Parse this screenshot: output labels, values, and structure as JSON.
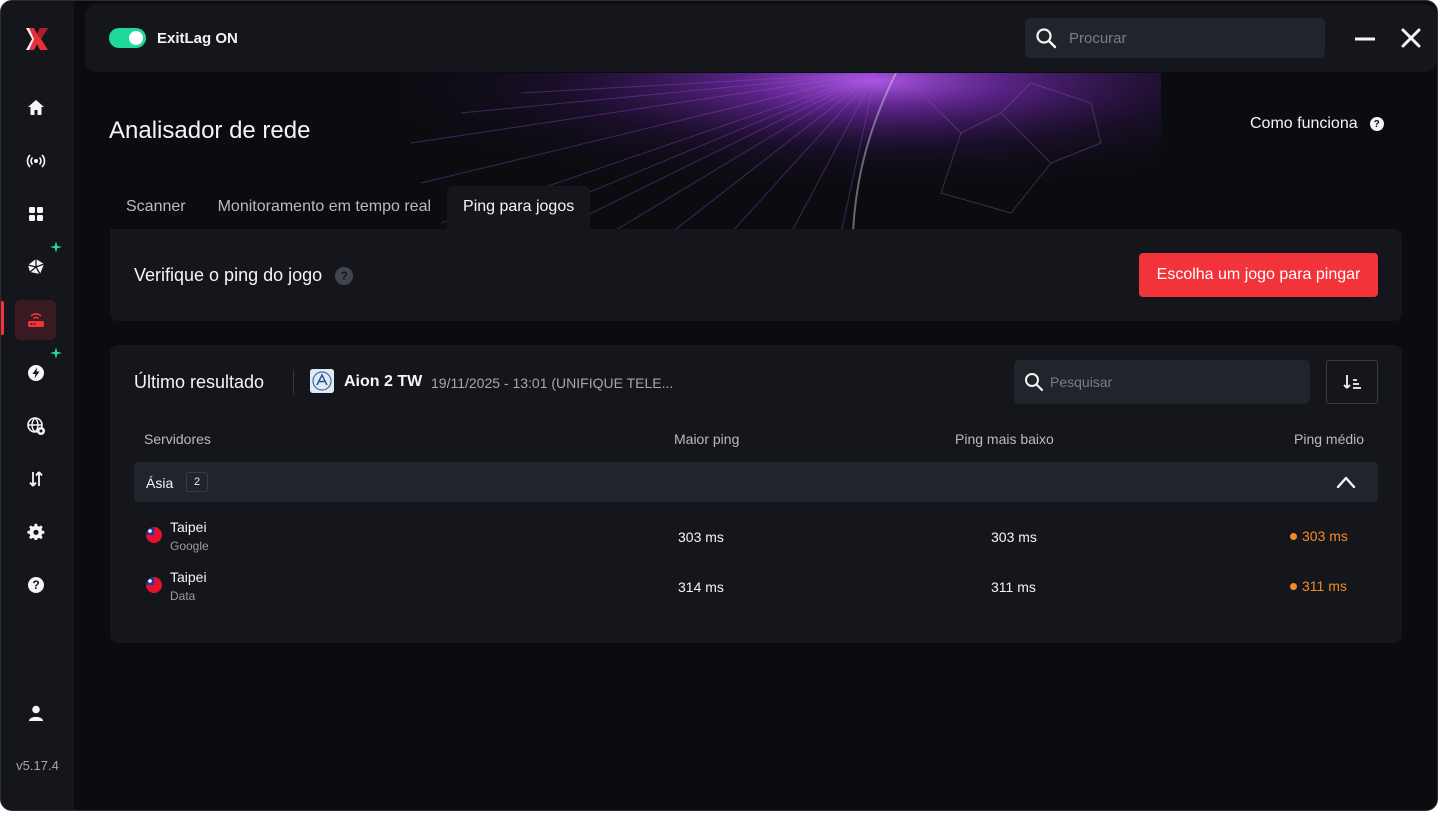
{
  "app": {
    "version": "v5.17.4",
    "status_label": "ExitLag ON",
    "search_placeholder": "Procurar"
  },
  "colors": {
    "accent_red": "#f2333a",
    "toggle_green": "#1ed99a",
    "ping_warning": "#f5892a"
  },
  "sidebar": {
    "items": [
      {
        "icon": "home-icon"
      },
      {
        "icon": "broadcast-icon"
      },
      {
        "icon": "apps-grid-icon"
      },
      {
        "icon": "cube-routes-icon"
      },
      {
        "icon": "router-icon",
        "active": true
      },
      {
        "icon": "boost-icon"
      },
      {
        "icon": "globe-settings-icon"
      },
      {
        "icon": "transfer-arrows-icon"
      },
      {
        "icon": "gear-icon"
      },
      {
        "icon": "help-icon"
      },
      {
        "icon": "user-icon"
      }
    ]
  },
  "page": {
    "title": "Analisador de rede",
    "how_it_works": "Como funciona"
  },
  "tabs": [
    {
      "label": "Scanner"
    },
    {
      "label": "Monitoramento em tempo real"
    },
    {
      "label": "Ping para jogos",
      "active": true
    }
  ],
  "ping_check": {
    "title": "Verifique o ping do jogo",
    "button": "Escolha um jogo para pingar"
  },
  "result": {
    "title": "Último resultado",
    "game_name": "Aion 2 TW",
    "info": "19/11/2025 - 13:01 (UNIFIQUE TELE...",
    "search_placeholder": "Pesquisar",
    "columns": [
      "Servidores",
      "Maior ping",
      "Ping mais baixo",
      "Ping médio"
    ],
    "groups": [
      {
        "label": "Ásia",
        "count": "2",
        "rows": [
          {
            "server": "Taipei",
            "provider": "Google",
            "max": "303 ms",
            "min": "303 ms",
            "avg": "303 ms"
          },
          {
            "server": "Taipei",
            "provider": "Data",
            "max": "314 ms",
            "min": "311 ms",
            "avg": "311 ms"
          }
        ]
      }
    ]
  }
}
